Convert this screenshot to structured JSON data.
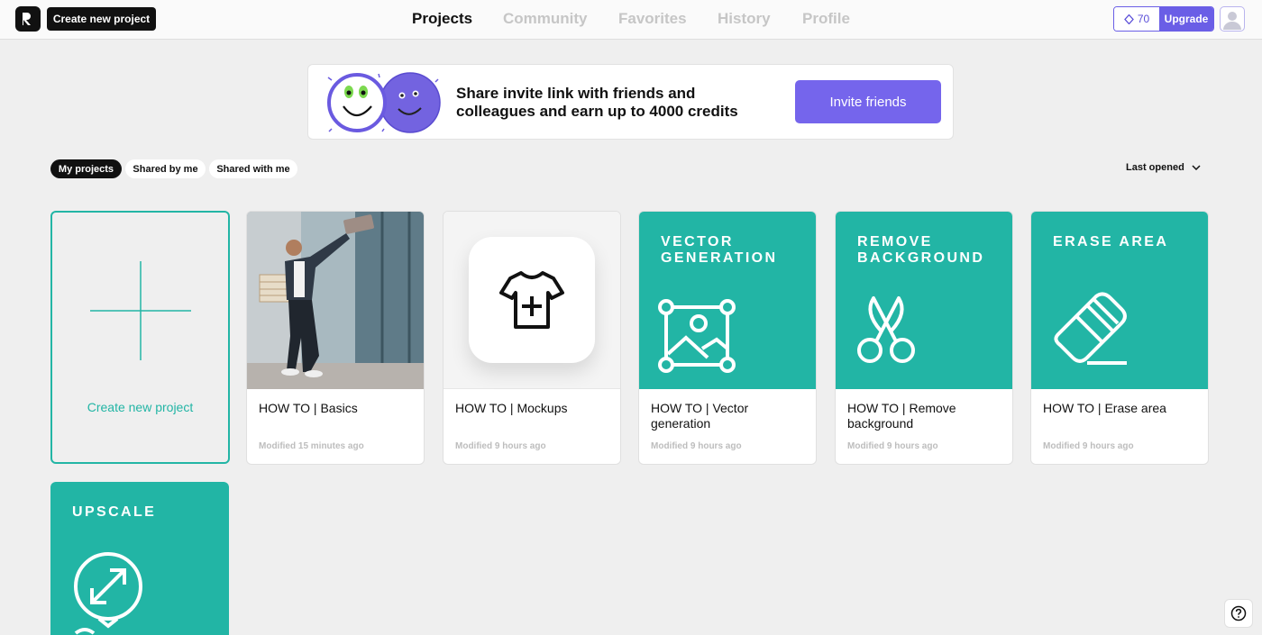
{
  "topbar": {
    "create_button": "Create new project",
    "nav": [
      {
        "label": "Projects",
        "active": true
      },
      {
        "label": "Community",
        "active": false
      },
      {
        "label": "Favorites",
        "active": false
      },
      {
        "label": "History",
        "active": false
      },
      {
        "label": "Profile",
        "active": false
      }
    ],
    "credits": "70",
    "upgrade_label": "Upgrade"
  },
  "banner": {
    "text": "Share invite link with friends and colleagues and earn up to 4000 credits",
    "button_label": "Invite friends"
  },
  "filters": {
    "tabs": [
      {
        "label": "My projects",
        "active": true
      },
      {
        "label": "Shared by me",
        "active": false
      },
      {
        "label": "Shared with me",
        "active": false
      }
    ],
    "sort_label": "Last opened"
  },
  "create_card": {
    "label": "Create new project"
  },
  "projects": [
    {
      "title": "HOW TO | Basics",
      "modified": "Modified 15 minutes ago",
      "thumb": "photo-man-laptop",
      "icon": "photo"
    },
    {
      "title": "HOW TO | Mockups",
      "modified": "Modified 9 hours ago",
      "thumb": "tshirt-plus-icon",
      "icon": "tshirt-plus-icon"
    },
    {
      "title": "HOW TO | Vector generation",
      "modified": "Modified 9 hours ago",
      "label": "VECTOR GENERATION",
      "icon": "vector-image-icon"
    },
    {
      "title": "HOW TO | Remove background",
      "modified": "Modified 9 hours ago",
      "label": "REMOVE BACKGROUND",
      "icon": "scissors-icon"
    },
    {
      "title": "HOW TO | Erase area",
      "modified": "Modified 9 hours ago",
      "label": "ERASE AREA",
      "icon": "eraser-icon"
    },
    {
      "label": "UPSCALE",
      "icon": "upscale-icon"
    }
  ],
  "colors": {
    "accent": "#22b5a5",
    "brand": "#7565ec",
    "dark": "#111111"
  }
}
